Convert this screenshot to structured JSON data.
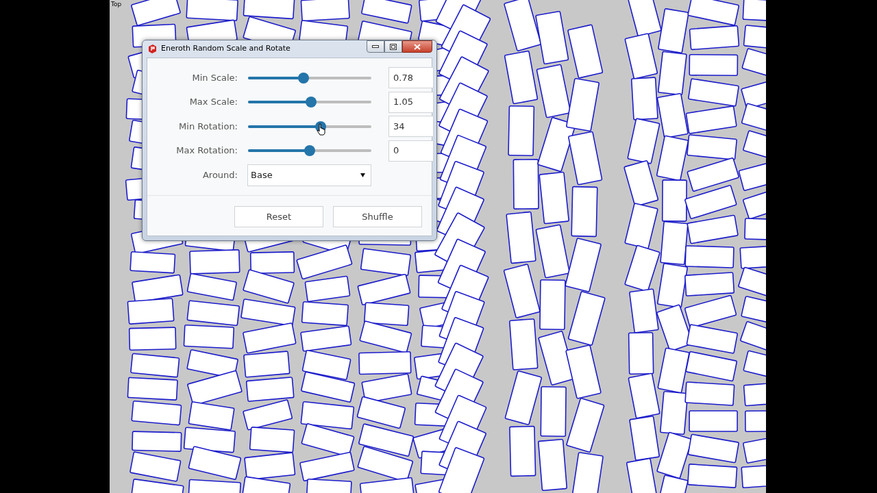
{
  "viewport": {
    "label": "Top"
  },
  "dialog": {
    "title": "Eneroth Random Scale and Rotate",
    "sliders": [
      {
        "label": "Min Scale:",
        "level": 0.45,
        "value": "0.78"
      },
      {
        "label": "Max Scale:",
        "level": 0.51,
        "value": "1.05"
      },
      {
        "label": "Min Rotation:",
        "level": 0.59,
        "value": "34"
      },
      {
        "label": "Max Rotation:",
        "level": 0.5,
        "value": "0"
      }
    ],
    "around": {
      "label": "Around:",
      "value": "Base"
    },
    "buttons": [
      "Reset",
      "Shuffle"
    ]
  }
}
